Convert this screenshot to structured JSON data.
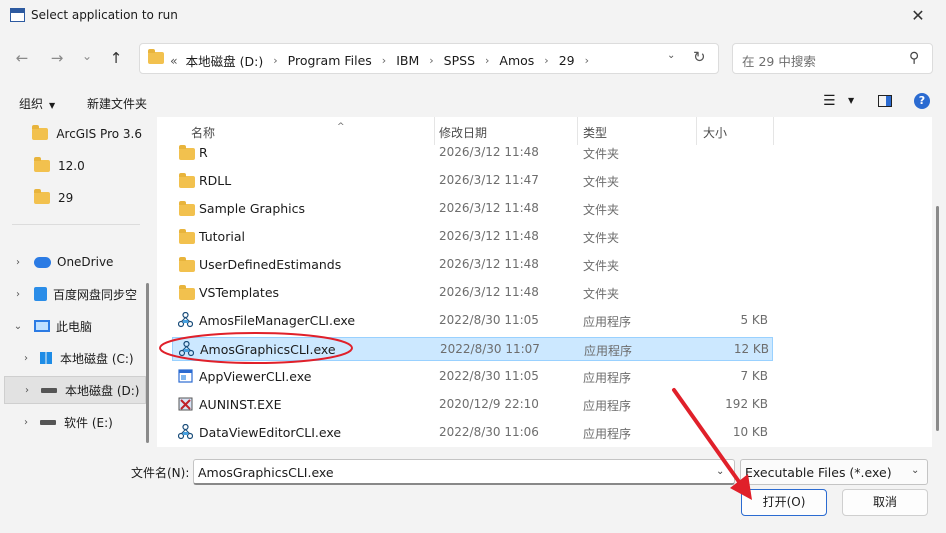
{
  "window": {
    "title": "Select application to run",
    "close_glyph": "✕"
  },
  "nav": {
    "back": "←",
    "forward": "→",
    "recent": "⌄",
    "up": "↑"
  },
  "address": {
    "overflow": "«",
    "crumbs": [
      "本地磁盘 (D:)",
      "Program Files",
      "IBM",
      "SPSS",
      "Amos",
      "29"
    ],
    "separator": "›"
  },
  "search": {
    "placeholder": "在 29 中搜索"
  },
  "toolbar": {
    "organize": "组织",
    "new_folder": "新建文件夹"
  },
  "sidebar": {
    "items": [
      {
        "label": "ArcGIS Pro 3.6",
        "icon": "folder-icon"
      },
      {
        "label": "12.0",
        "icon": "folder-icon"
      },
      {
        "label": "29",
        "icon": "folder-icon"
      },
      {
        "label": "OneDrive",
        "icon": "onedrive-icon"
      },
      {
        "label": "百度网盘同步空",
        "icon": "baidu-icon"
      },
      {
        "label": "此电脑",
        "icon": "computer-icon"
      },
      {
        "label": "本地磁盘 (C:)",
        "icon": "windows-drive-icon"
      },
      {
        "label": "本地磁盘 (D:)",
        "icon": "drive-icon"
      },
      {
        "label": "软件 (E:)",
        "icon": "drive-icon"
      }
    ]
  },
  "columns": {
    "name": "名称",
    "date": "修改日期",
    "type": "类型",
    "size": "大小"
  },
  "files": [
    {
      "name": "R",
      "date": "2026/3/12 11:48",
      "type": "文件夹",
      "size": "",
      "kind": "folder"
    },
    {
      "name": "RDLL",
      "date": "2026/3/12 11:47",
      "type": "文件夹",
      "size": "",
      "kind": "folder"
    },
    {
      "name": "Sample Graphics",
      "date": "2026/3/12 11:48",
      "type": "文件夹",
      "size": "",
      "kind": "folder"
    },
    {
      "name": "Tutorial",
      "date": "2026/3/12 11:48",
      "type": "文件夹",
      "size": "",
      "kind": "folder"
    },
    {
      "name": "UserDefinedEstimands",
      "date": "2026/3/12 11:48",
      "type": "文件夹",
      "size": "",
      "kind": "folder"
    },
    {
      "name": "VSTemplates",
      "date": "2026/3/12 11:48",
      "type": "文件夹",
      "size": "",
      "kind": "folder"
    },
    {
      "name": "AmosFileManagerCLI.exe",
      "date": "2022/8/30 11:05",
      "type": "应用程序",
      "size": "5 KB",
      "kind": "exe"
    },
    {
      "name": "AmosGraphicsCLI.exe",
      "date": "2022/8/30 11:07",
      "type": "应用程序",
      "size": "12 KB",
      "kind": "exe",
      "selected": true
    },
    {
      "name": "AppViewerCLI.exe",
      "date": "2022/8/30 11:05",
      "type": "应用程序",
      "size": "7 KB",
      "kind": "app"
    },
    {
      "name": "AUNINST.EXE",
      "date": "2020/12/9 22:10",
      "type": "应用程序",
      "size": "192 KB",
      "kind": "uninst"
    },
    {
      "name": "DataViewEditorCLI.exe",
      "date": "2022/8/30 11:06",
      "type": "应用程序",
      "size": "10 KB",
      "kind": "exe"
    }
  ],
  "bottom": {
    "filename_label": "文件名(N):",
    "filename_value": "AmosGraphicsCLI.exe",
    "filetype_value": "Executable Files (*.exe)",
    "open_label": "打开(O)",
    "cancel_label": "取消"
  },
  "colors": {
    "accent": "#2b6bd1",
    "selection": "#cce8ff",
    "annotation": "#e0202a",
    "folder": "#f2c14e"
  }
}
